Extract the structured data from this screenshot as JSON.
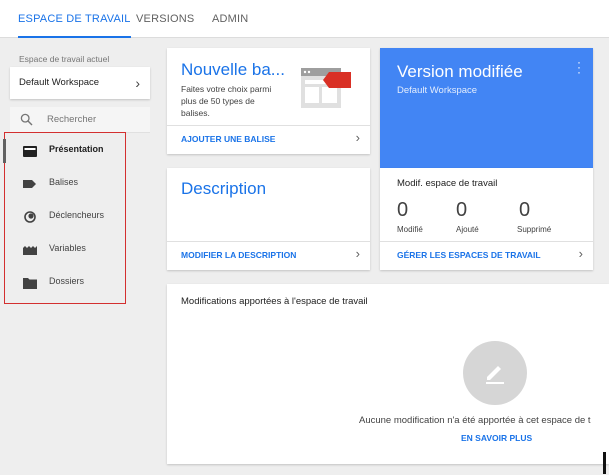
{
  "tabs": [
    {
      "label": "ESPACE DE TRAVAIL",
      "active": true
    },
    {
      "label": "VERSIONS",
      "active": false
    },
    {
      "label": "ADMIN",
      "active": false
    }
  ],
  "sidebar": {
    "workspace_label": "Espace de travail actuel",
    "workspace_value": "Default Workspace",
    "search_placeholder": "Rechercher",
    "items": [
      {
        "label": "Présentation",
        "icon": "folder-open-icon",
        "active": true
      },
      {
        "label": "Balises",
        "icon": "tag-icon",
        "active": false
      },
      {
        "label": "Déclencheurs",
        "icon": "trigger-icon",
        "active": false
      },
      {
        "label": "Variables",
        "icon": "variables-icon",
        "active": false
      },
      {
        "label": "Dossiers",
        "icon": "folder-icon",
        "active": false
      }
    ]
  },
  "new_tag_card": {
    "title": "Nouvelle ba...",
    "desc_line1": "Faites votre choix parmi",
    "desc_line2": "plus de 50 types de",
    "desc_line3": "balises.",
    "link": "AJOUTER UNE BALISE"
  },
  "version_card": {
    "title": "Version modifiée",
    "subtitle": "Default Workspace"
  },
  "description_card": {
    "title": "Description",
    "link": "MODIFIER LA DESCRIPTION"
  },
  "workspace_changes_card": {
    "title": "Modif. espace de travail",
    "stats": [
      {
        "value": "0",
        "label": "Modifié"
      },
      {
        "value": "0",
        "label": "Ajouté"
      },
      {
        "value": "0",
        "label": "Supprimé"
      }
    ],
    "link": "GÉRER LES ESPACES DE TRAVAIL"
  },
  "modifications_card": {
    "title": "Modifications apportées à l'espace de travail",
    "empty_text": "Aucune modification n'a été apportée à cet espace de t",
    "learn_more": "EN SAVOIR PLUS"
  },
  "colors": {
    "accent": "#1a73e8",
    "version_bg": "#4285f4",
    "highlight_box": "#d32f2f"
  }
}
